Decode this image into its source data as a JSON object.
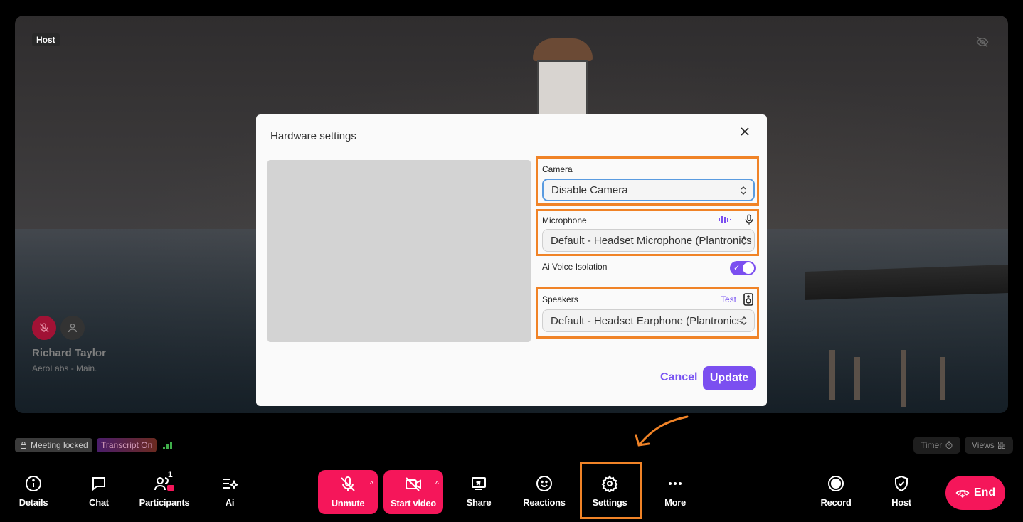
{
  "video": {
    "host_tag": "Host",
    "participant_name": "Richard Taylor",
    "participant_org": "AeroLabs - Main."
  },
  "modal": {
    "title": "Hardware settings",
    "camera_label": "Camera",
    "camera_value": "Disable Camera",
    "microphone_label": "Microphone",
    "microphone_value": "Default - Headset Microphone (Plantronics",
    "voice_isolation_label": "Ai Voice Isolation",
    "voice_isolation_on": true,
    "speakers_label": "Speakers",
    "speakers_test": "Test",
    "speakers_value": "Default - Headset Earphone (Plantronics",
    "cancel_label": "Cancel",
    "update_label": "Update"
  },
  "status": {
    "locked": "Meeting locked",
    "transcript": "Transcript On",
    "timer": "Timer",
    "views": "Views"
  },
  "toolbar": {
    "details": "Details",
    "chat": "Chat",
    "participants": "Participants",
    "participants_count": "1",
    "ai": "Ai",
    "unmute": "Unmute",
    "start_video": "Start video",
    "share": "Share",
    "reactions": "Reactions",
    "settings": "Settings",
    "more": "More",
    "record": "Record",
    "host": "Host",
    "end": "End"
  },
  "colors": {
    "accent": "#7b4ff0",
    "danger": "#f5165a",
    "highlight": "#f08327"
  }
}
